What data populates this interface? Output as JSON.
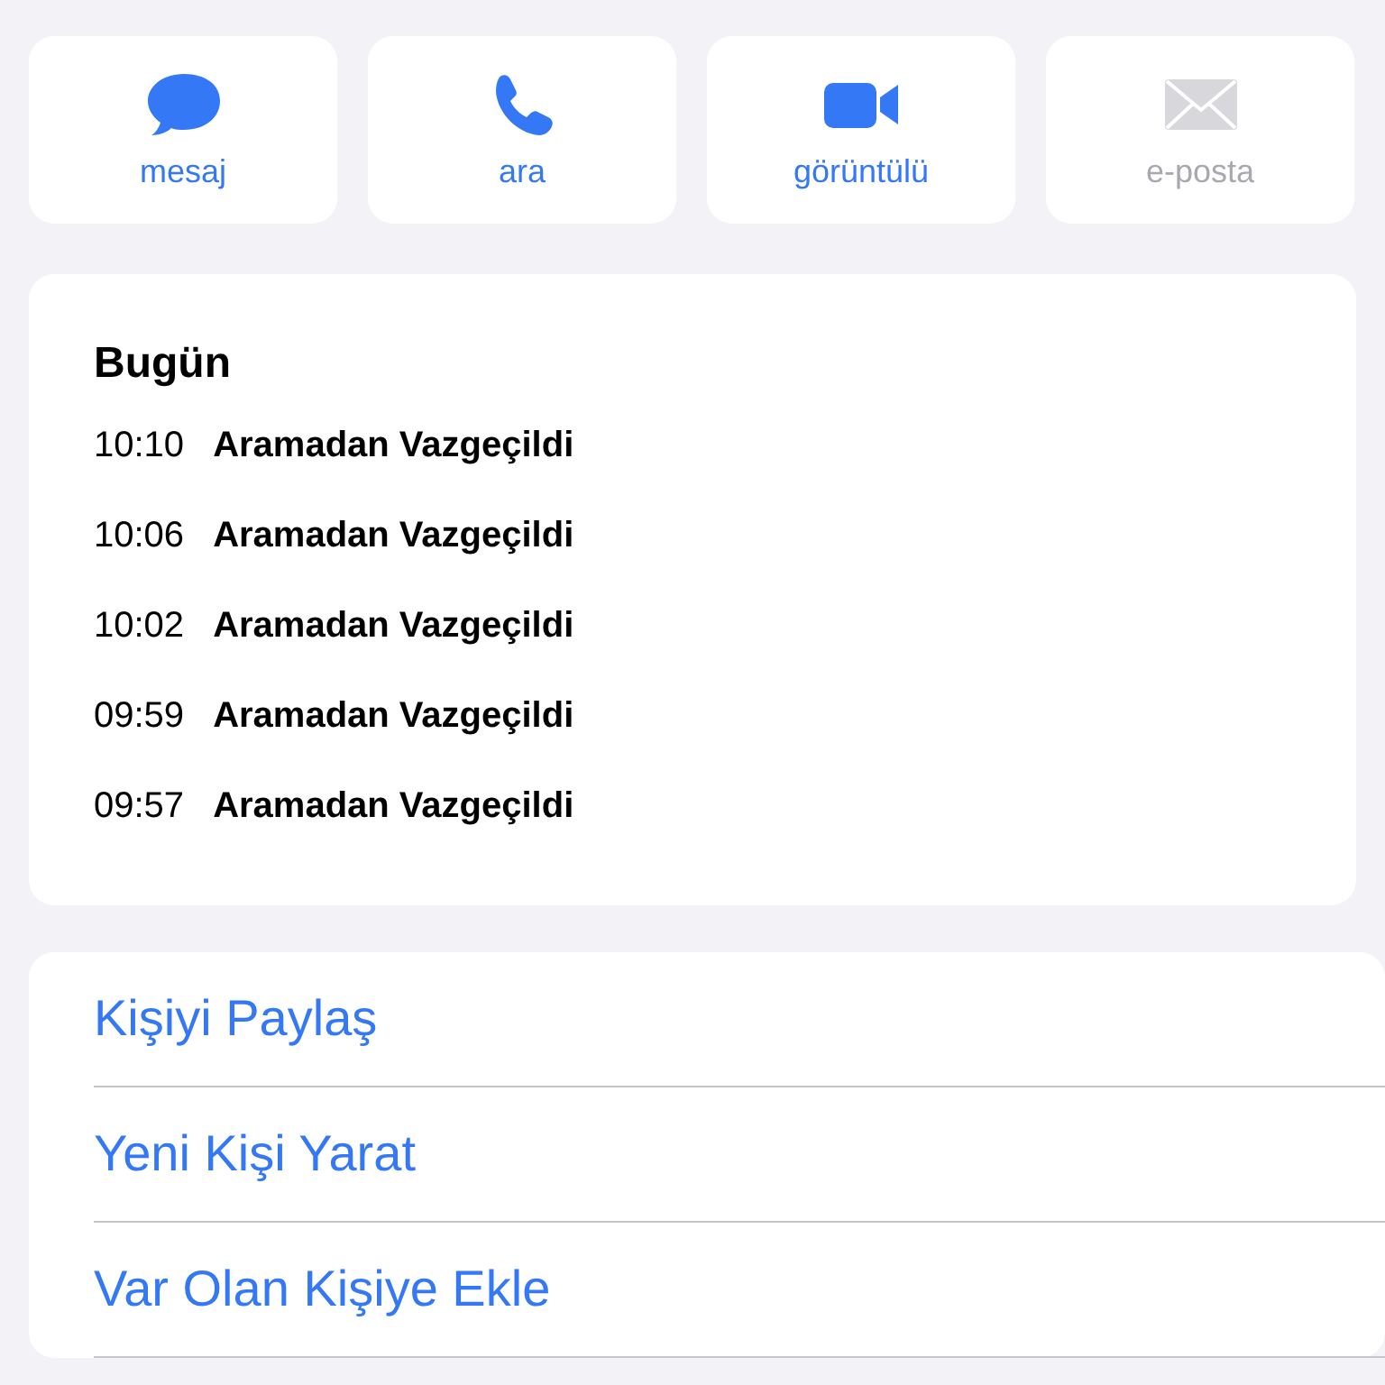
{
  "actions": [
    {
      "kind": "message",
      "label": "mesaj",
      "disabled": false
    },
    {
      "kind": "phone",
      "label": "ara",
      "disabled": false
    },
    {
      "kind": "video",
      "label": "görüntülü",
      "disabled": false
    },
    {
      "kind": "mail",
      "label": "e-posta",
      "disabled": true
    }
  ],
  "recents": {
    "title": "Bugün",
    "calls": [
      {
        "time": "10:10",
        "status": "Aramadan Vazgeçildi"
      },
      {
        "time": "10:06",
        "status": "Aramadan Vazgeçildi"
      },
      {
        "time": "10:02",
        "status": "Aramadan Vazgeçildi"
      },
      {
        "time": "09:59",
        "status": "Aramadan Vazgeçildi"
      },
      {
        "time": "09:57",
        "status": "Aramadan Vazgeçildi"
      }
    ]
  },
  "options": [
    "Kişiyi Paylaş",
    "Yeni Kişi Yarat",
    "Var Olan Kişiye Ekle"
  ]
}
